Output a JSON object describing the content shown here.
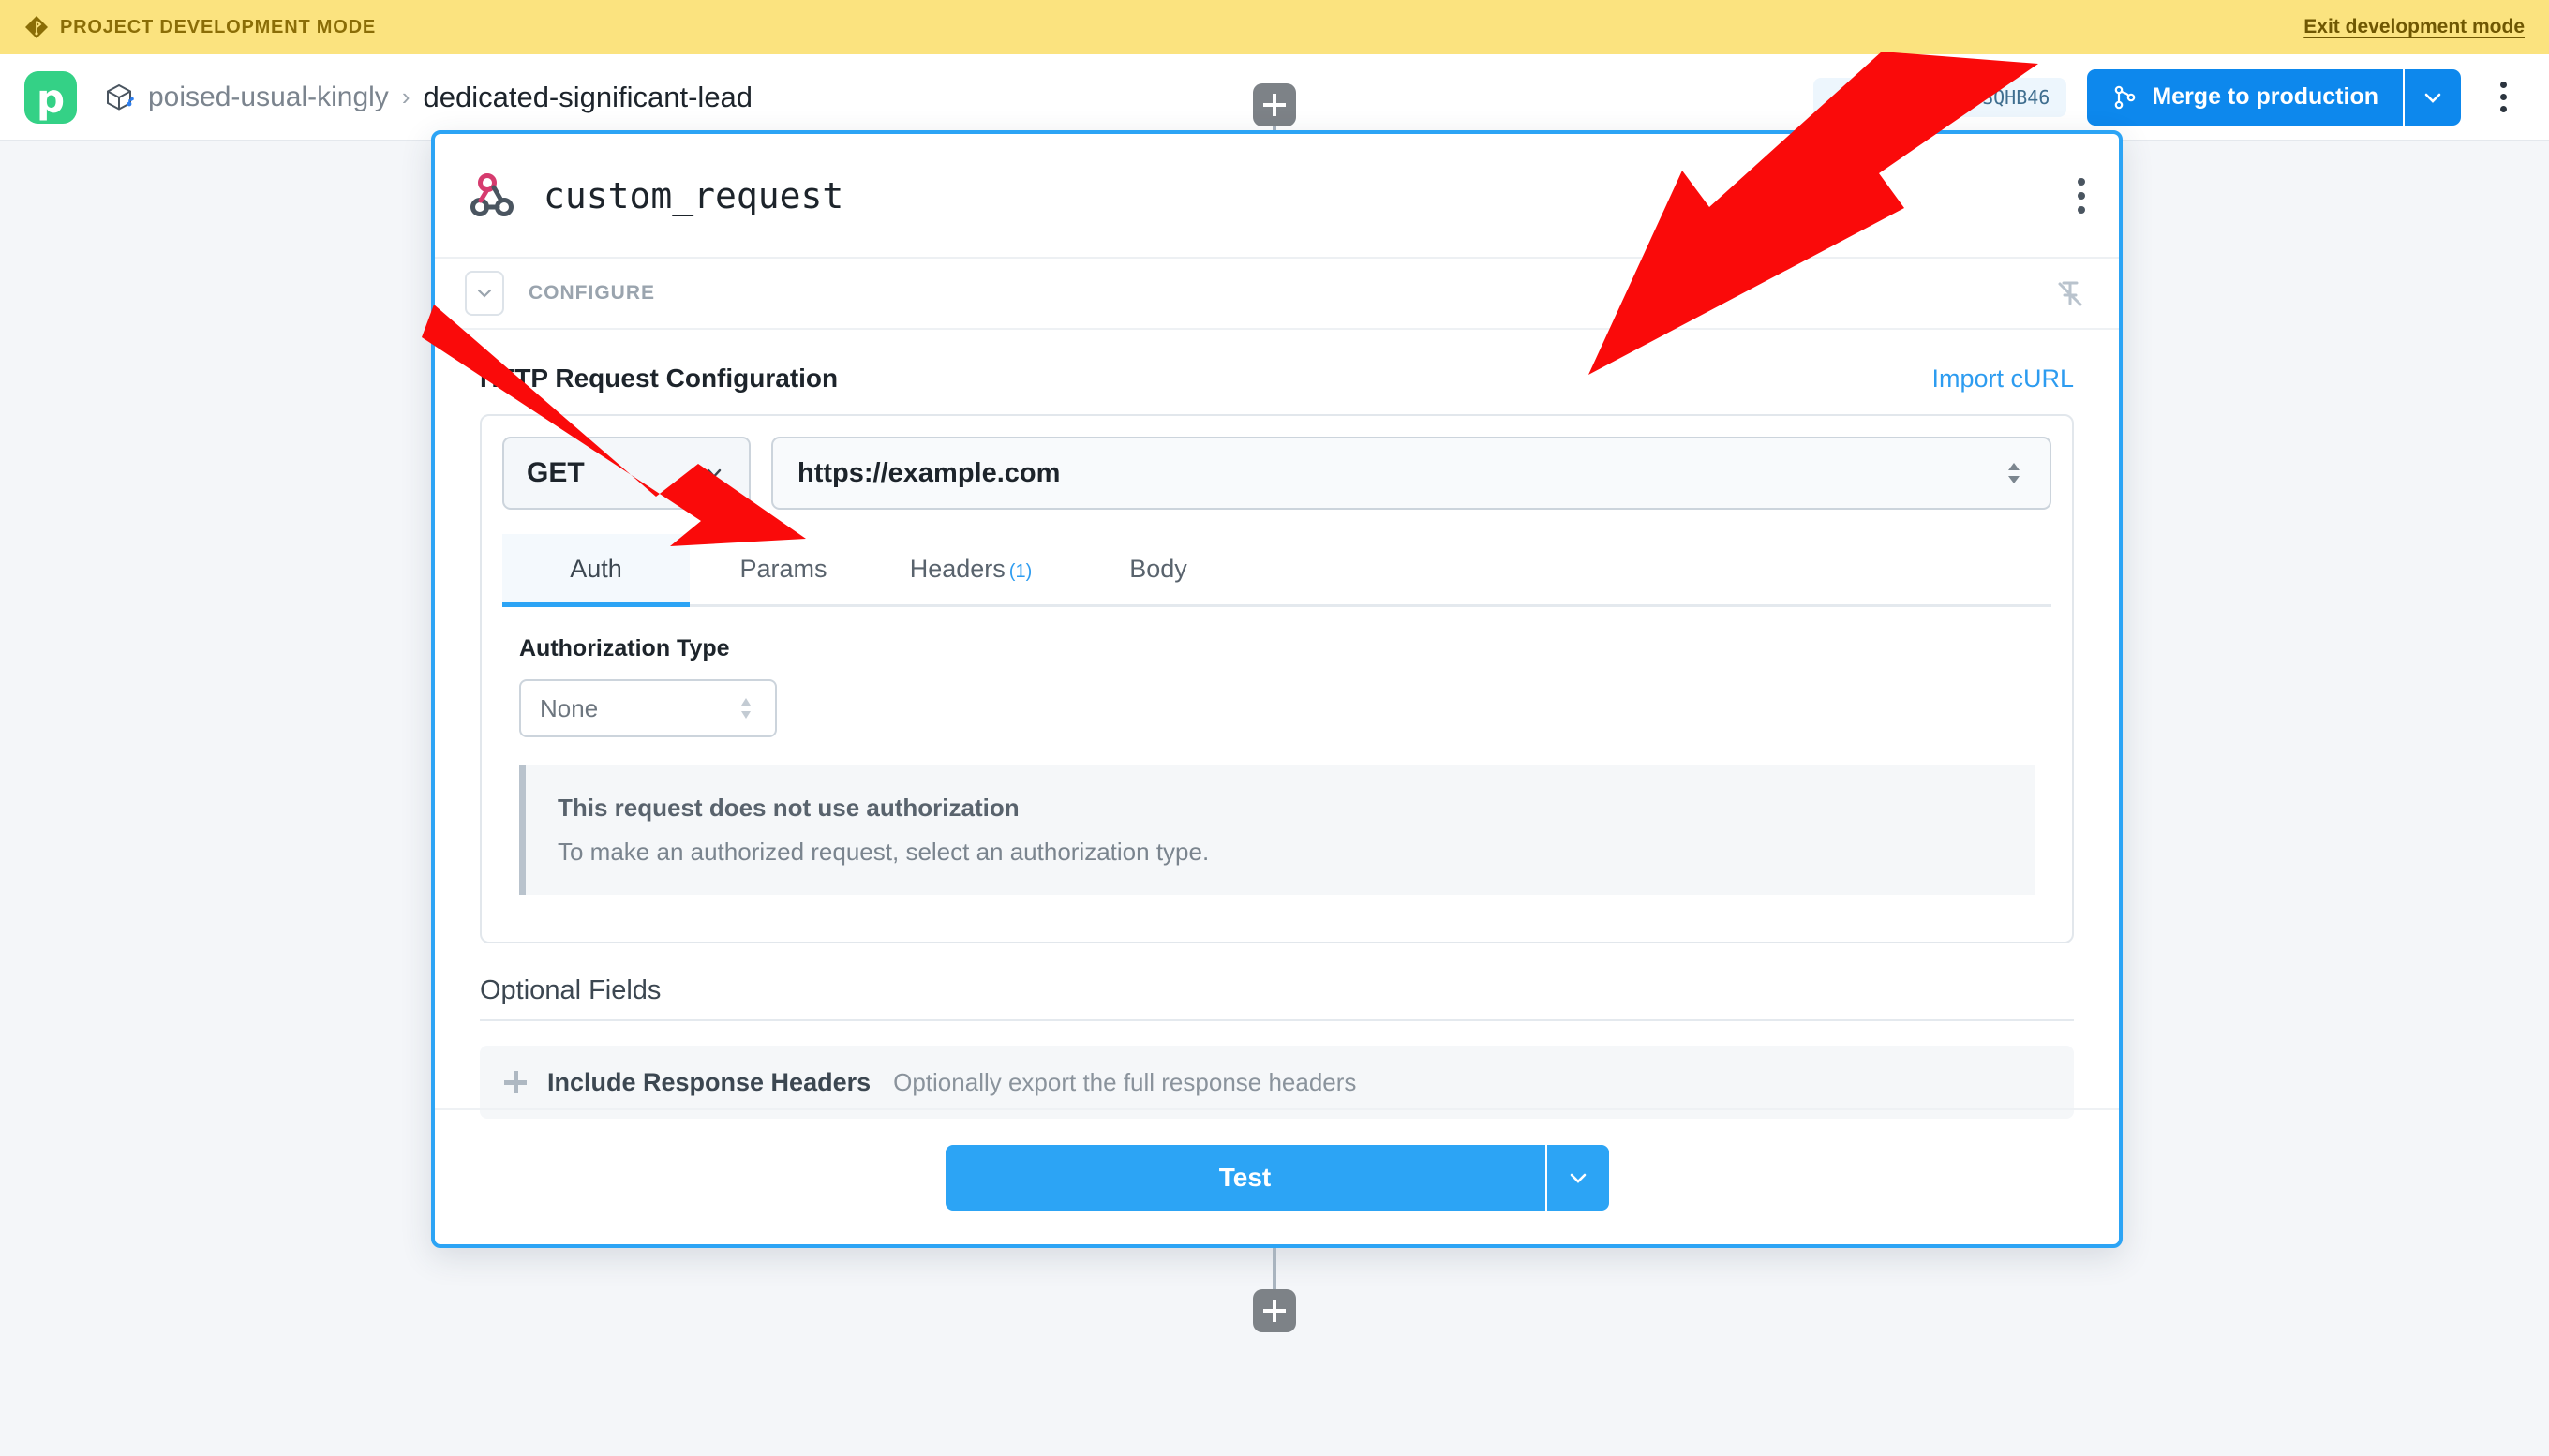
{
  "dev_banner": {
    "icon": "diamond-branch-icon",
    "label": "PROJECT DEVELOPMENT MODE",
    "exit_label": "Exit development mode",
    "background": "#fbe37f",
    "text_color": "#8a6d07"
  },
  "topbar": {
    "logo_letter": "p",
    "logo_color": "#34d186",
    "breadcrumb": {
      "project_icon": "cube-branch-icon",
      "project": "poised-usual-kingly",
      "separator": "›",
      "current": "dedicated-significant-lead"
    },
    "branch_badge": {
      "glyph": "⎇",
      "label": "dev-pravin-SQHB46",
      "background": "#edf6fd",
      "text_color": "#3f6e8f"
    },
    "merge_button": {
      "icon": "merge-branch-icon",
      "label": "Merge to production",
      "background": "#0d88ed",
      "dropdown_icon": "chevron-down-icon"
    },
    "overflow_menu_icon": "kebab-menu-icon"
  },
  "canvas": {
    "background": "#f4f6f9",
    "add_node_top_label": "+",
    "add_node_bottom_label": "+"
  },
  "node_card": {
    "border_color": "#2ca4f5",
    "header": {
      "icon": "webhook-icon",
      "title": "custom_request",
      "menu_icon": "kebab-menu-icon"
    },
    "configure_bar": {
      "collapse_icon": "chevron-down-icon",
      "label": "CONFIGURE",
      "pin_icon": "pin-off-icon"
    },
    "request_section": {
      "title": "HTTP Request Configuration",
      "import_curl_label": "Import cURL",
      "import_curl_color": "#2d9cf0",
      "method": {
        "value": "GET",
        "chevron_icon": "chevron-down-icon"
      },
      "url": {
        "value": "https://example.com",
        "placeholder": "https://example.com",
        "spinner_icon": "updown-arrows-icon"
      }
    },
    "tabs": [
      {
        "label": "Auth",
        "badge": "",
        "active": true
      },
      {
        "label": "Params",
        "badge": "",
        "active": false
      },
      {
        "label": "Headers",
        "badge": "(1)",
        "active": false
      },
      {
        "label": "Body",
        "badge": "",
        "active": false
      }
    ],
    "auth_pane": {
      "field_label": "Authorization Type",
      "select_value": "None",
      "select_icon": "updown-arrows-icon",
      "note_title": "This request does not use authorization",
      "note_body": "To make an authorized request, select an authorization type."
    },
    "optional_fields": {
      "title": "Optional Fields",
      "rows": [
        {
          "add_icon": "plus-icon",
          "name": "Include Response Headers",
          "description": "Optionally export the full response headers"
        }
      ]
    },
    "footer": {
      "test_label": "Test",
      "test_color": "#2ca4f5",
      "dropdown_icon": "chevron-down-icon"
    }
  },
  "annotations": {
    "arrow_color": "#fa0a0a",
    "arrow_count": 2
  }
}
